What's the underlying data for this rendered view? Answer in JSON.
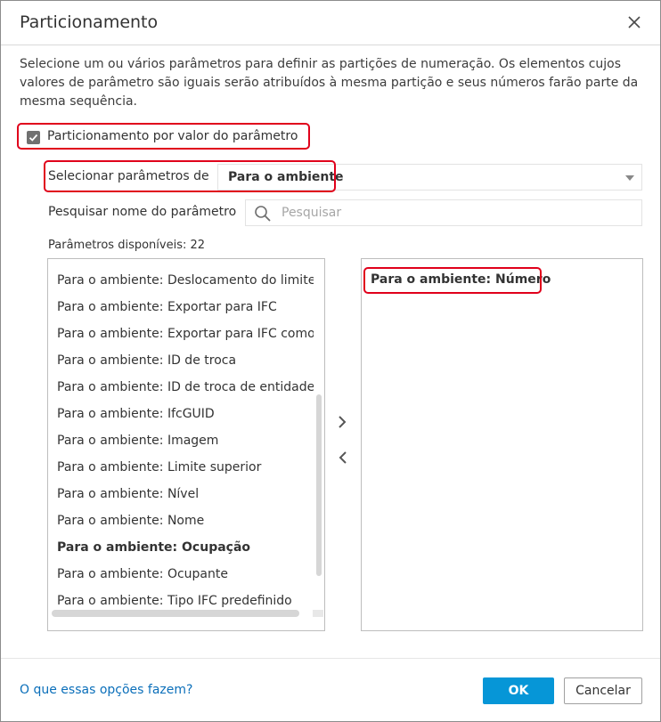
{
  "dialog": {
    "title": "Particionamento",
    "description": "Selecione um ou vários parâmetros para definir as partições de numeração. Os elementos cujos valores de parâmetro são iguais serão atribuídos à mesma partição e seus números farão parte da mesma sequência."
  },
  "partition_checkbox": {
    "label": "Particionamento por valor do parâmetro",
    "checked": true
  },
  "select_params": {
    "label": "Selecionar parâmetros de",
    "value": "Para o ambiente"
  },
  "search": {
    "label": "Pesquisar nome do parâmetro",
    "placeholder": "Pesquisar",
    "value": ""
  },
  "available": {
    "label": "Parâmetros disponíveis:",
    "count": "22",
    "items": [
      {
        "text": "Para o ambiente: Deslocamento do limite",
        "bold": false
      },
      {
        "text": "Para o ambiente: Exportar para IFC",
        "bold": false
      },
      {
        "text": "Para o ambiente: Exportar para IFC como",
        "bold": false
      },
      {
        "text": "Para o ambiente: ID de troca",
        "bold": false
      },
      {
        "text": "Para o ambiente: ID de troca de entidade",
        "bold": false
      },
      {
        "text": "Para o ambiente: IfcGUID",
        "bold": false
      },
      {
        "text": "Para o ambiente: Imagem",
        "bold": false
      },
      {
        "text": "Para o ambiente: Limite superior",
        "bold": false
      },
      {
        "text": "Para o ambiente: Nível",
        "bold": false
      },
      {
        "text": "Para o ambiente: Nome",
        "bold": false
      },
      {
        "text": "Para o ambiente: Ocupação",
        "bold": true
      },
      {
        "text": "Para o ambiente: Ocupante",
        "bold": false
      },
      {
        "text": "Para o ambiente: Tipo IFC predefinido",
        "bold": false
      }
    ]
  },
  "selected": {
    "items": [
      "Para o ambiente: Número"
    ]
  },
  "footer": {
    "help_link": "O que essas opções fazem?",
    "ok_label": "OK",
    "cancel_label": "Cancelar"
  },
  "icons": {
    "close": "close-icon",
    "search": "search-icon",
    "add": "chevron-right-icon",
    "remove": "chevron-left-icon",
    "checkbox": "checkmark-icon",
    "caret": "chevron-down-icon"
  },
  "colors": {
    "highlight_border": "#e0001b",
    "primary_button": "#0696d7",
    "link": "#0b6fba"
  }
}
